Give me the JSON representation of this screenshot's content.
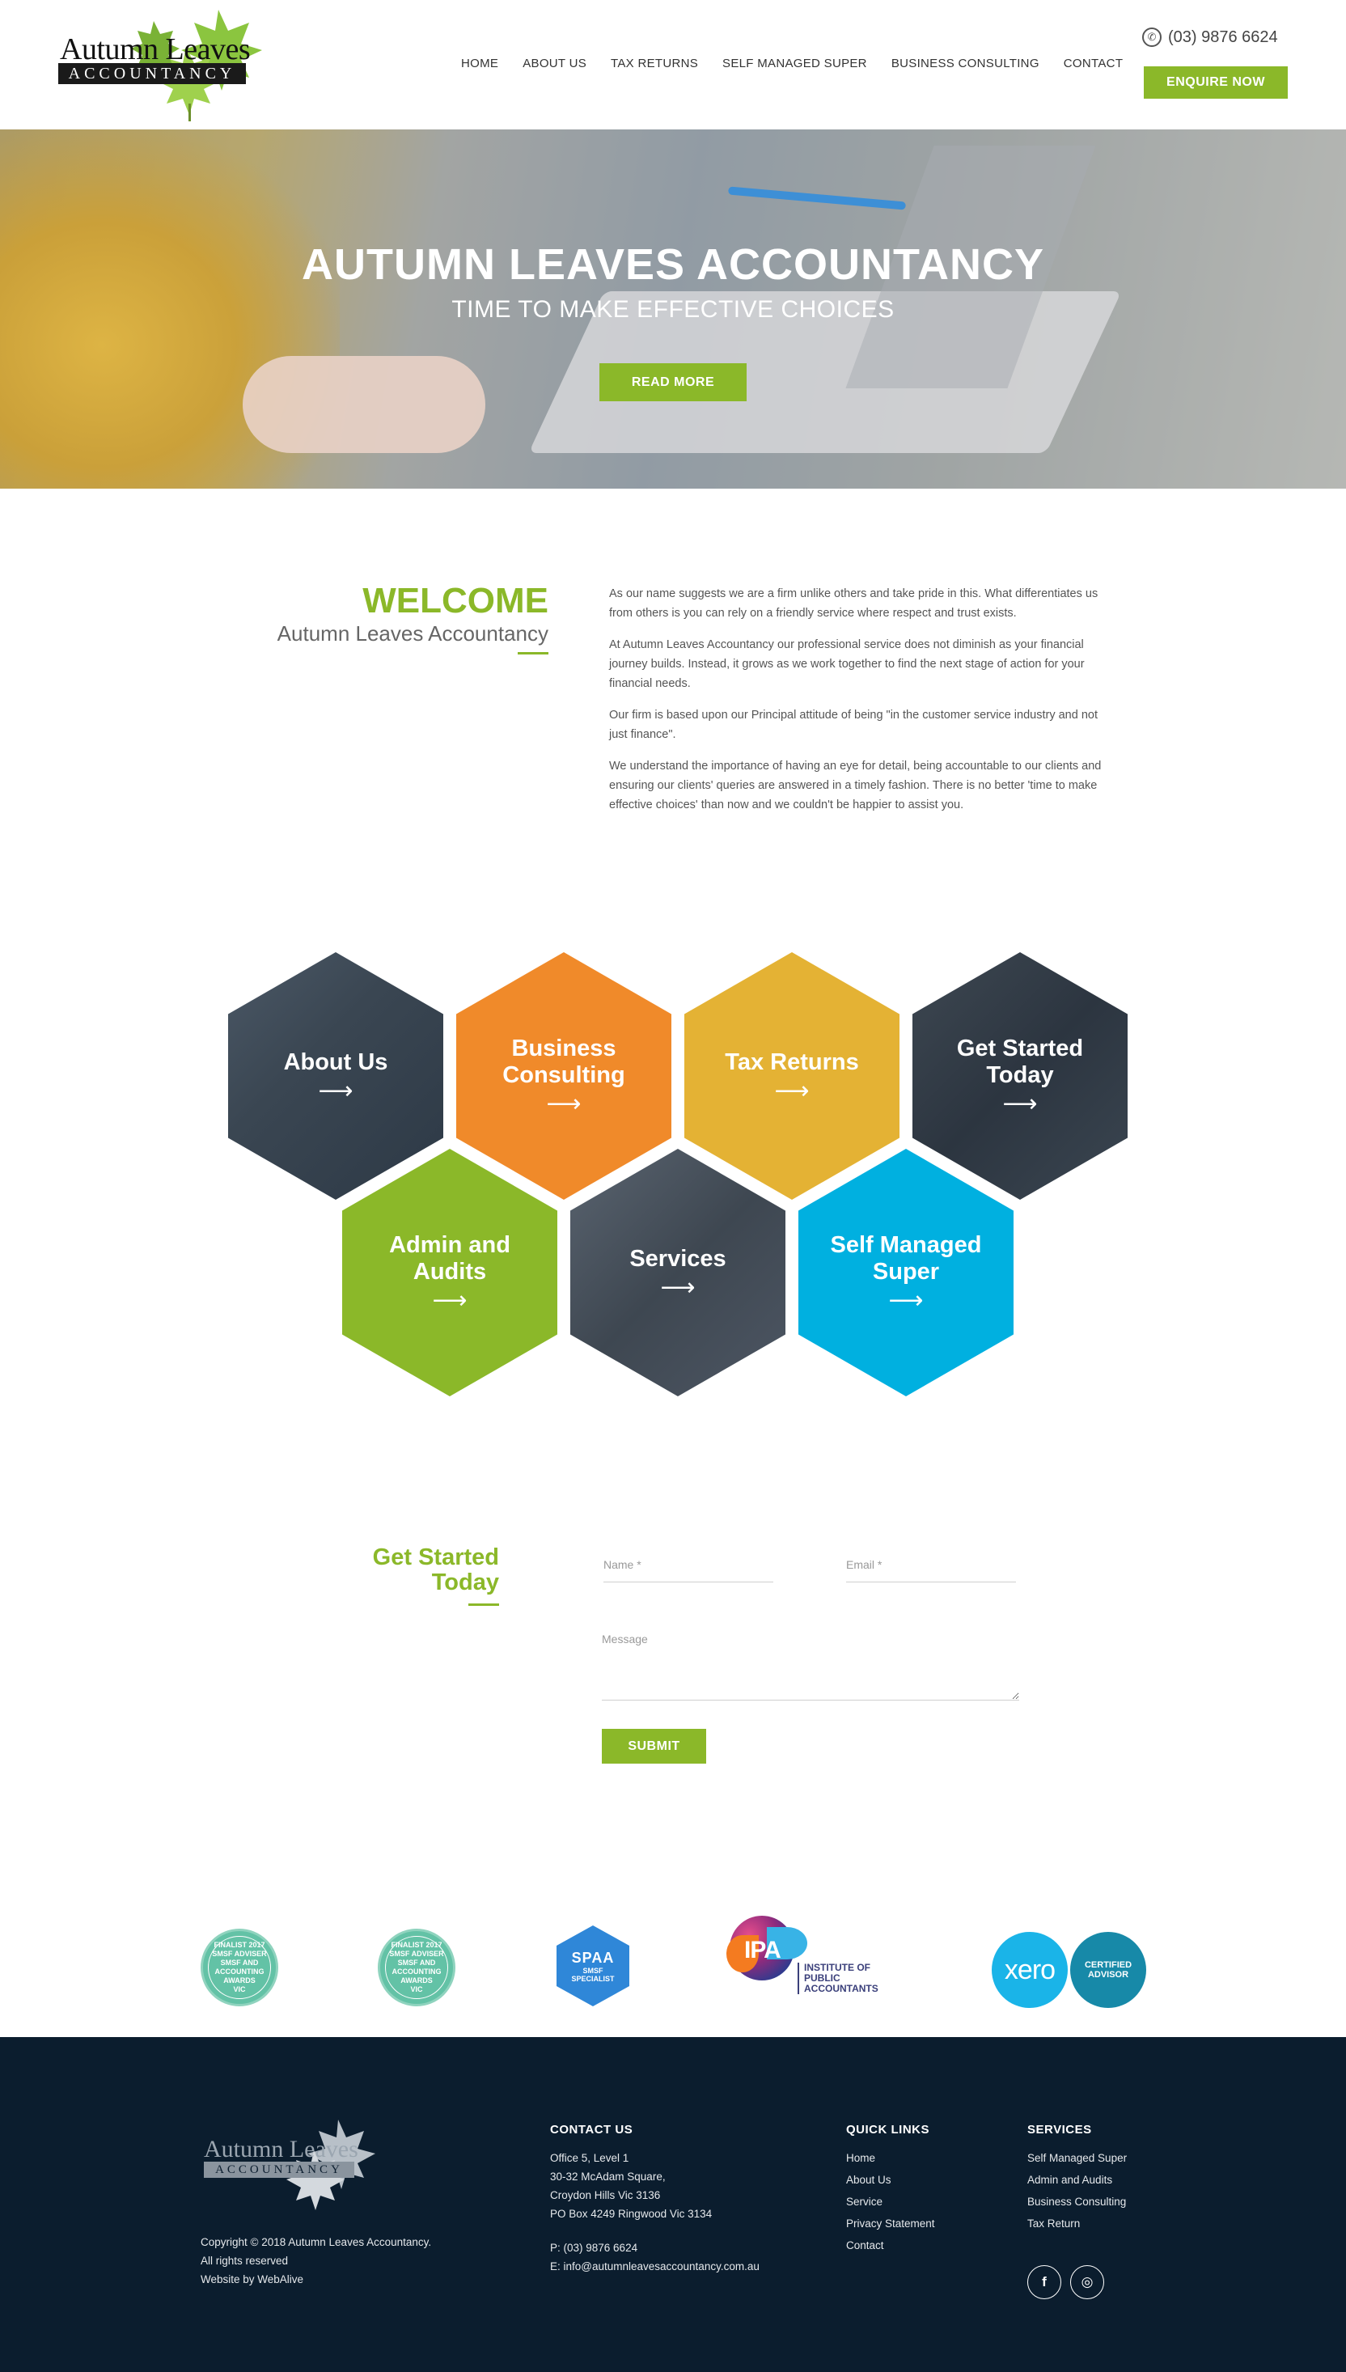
{
  "header": {
    "logo_name": "Autumn Leaves",
    "logo_bar": "ACCOUNTANCY",
    "nav": [
      "HOME",
      "ABOUT US",
      "TAX RETURNS",
      "SELF MANAGED SUPER",
      "BUSINESS CONSULTING",
      "CONTACT"
    ],
    "phone": "(03) 9876 6624",
    "enquire_label": "ENQUIRE NOW"
  },
  "hero": {
    "title": "AUTUMN LEAVES ACCOUNTANCY",
    "subtitle": "TIME TO MAKE EFFECTIVE CHOICES",
    "button": "READ MORE"
  },
  "welcome": {
    "title": "WELCOME",
    "subtitle": "Autumn Leaves Accountancy",
    "paragraphs": [
      "As our name suggests we are a firm unlike others and take pride in this. What differentiates us from others is you can rely on a friendly service where respect and trust exists.",
      "At Autumn Leaves Accountancy our professional service does not diminish as your financial journey builds. Instead, it grows as we work together to find the next stage of action for your financial needs.",
      "Our firm is based upon our Principal attitude of being \"in the customer service industry and not just finance\".",
      "We understand the importance of having an eye for detail, being accountable to our clients and ensuring our clients' queries are answered in a timely fashion. There is no better 'time to make effective choices' than now and we couldn't be happier to assist you."
    ]
  },
  "tiles": [
    {
      "label": "About Us",
      "arrow": "⟶"
    },
    {
      "label": "Business Consulting",
      "arrow": "⟶"
    },
    {
      "label": "Tax Returns",
      "arrow": "⟶"
    },
    {
      "label": "Get Started Today",
      "arrow": "⟶"
    },
    {
      "label": "Admin and Audits",
      "arrow": "⟶"
    },
    {
      "label": "Services",
      "arrow": "⟶"
    },
    {
      "label": "Self Managed Super",
      "arrow": "⟶"
    }
  ],
  "form": {
    "title": "Get Started Today",
    "name_placeholder": "Name *",
    "email_placeholder": "Email *",
    "message_placeholder": "Message",
    "submit": "SUBMIT"
  },
  "badges": {
    "finalist": [
      "FINALIST 2017",
      "SMSF ADVISER",
      "SMSF AND ACCOUNTING AWARDS",
      "VIC"
    ],
    "spaa": [
      "SPAA",
      "SMSF",
      "SPECIALIST"
    ],
    "ipa": {
      "letters": "IPA",
      "line1": "INSTITUTE OF",
      "line2": "PUBLIC",
      "line3": "ACCOUNTANTS"
    },
    "xero": "xero",
    "certified": [
      "CERTIFIED",
      "ADVISOR"
    ]
  },
  "footer": {
    "logo_name": "Autumn Leaves",
    "logo_bar": "ACCOUNTANCY",
    "copyright": "Copyright © 2018 Autumn Leaves Accountancy.",
    "rights": "All rights reserved",
    "credit": "Website by WebAlive",
    "contact_title": "CONTACT US",
    "address": [
      "Office 5, Level 1",
      "30-32 McAdam Square,",
      "Croydon Hills Vic 3136",
      "PO Box 4249 Ringwood Vic 3134"
    ],
    "phone": "P: (03) 9876 6624",
    "email": "E: info@autumnleavesaccountancy.com.au",
    "quick_title": "QUICK LINKS",
    "quick_links": [
      "Home",
      "About Us",
      "Service",
      "Privacy Statement",
      "Contact"
    ],
    "services_title": "SERVICES",
    "services": [
      "Self Managed Super",
      "Admin and Audits",
      "Business Consulting",
      "Tax Return"
    ],
    "social": {
      "facebook_icon": "f",
      "instagram_icon": "◎"
    }
  },
  "colors": {
    "green": "#8bb829",
    "orange": "#f08a2a",
    "yellow": "#e4b234",
    "blue": "#00b0e0",
    "footer_bg": "#0b1d2e"
  }
}
